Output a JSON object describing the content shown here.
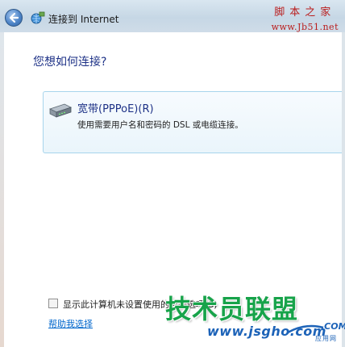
{
  "window": {
    "title": "连接到 Internet"
  },
  "main": {
    "heading": "您想如何连接?",
    "options": [
      {
        "title": "宽带(PPPoE)(R)",
        "description": "使用需要用户名和密码的 DSL 或电缆连接。",
        "icon": "modem-icon"
      }
    ],
    "checkbox_label": "显示此计算机未设置使用的连接选项(S)",
    "checkbox_checked": false,
    "help_link": "帮助我选择"
  },
  "watermarks": {
    "top_line1": "脚本之家",
    "top_line2": "www.Jb51.net",
    "bottom_big": "技术员联盟",
    "bottom_url": "www.jsgho.com",
    "bottom_com": ".COM",
    "bottom_sub": "应用网"
  },
  "colors": {
    "heading": "#1e3287",
    "link": "#0066cc",
    "card_border": "#a7d5ec",
    "watermark_green": "#17a34a",
    "watermark_red": "#b91c1c"
  }
}
